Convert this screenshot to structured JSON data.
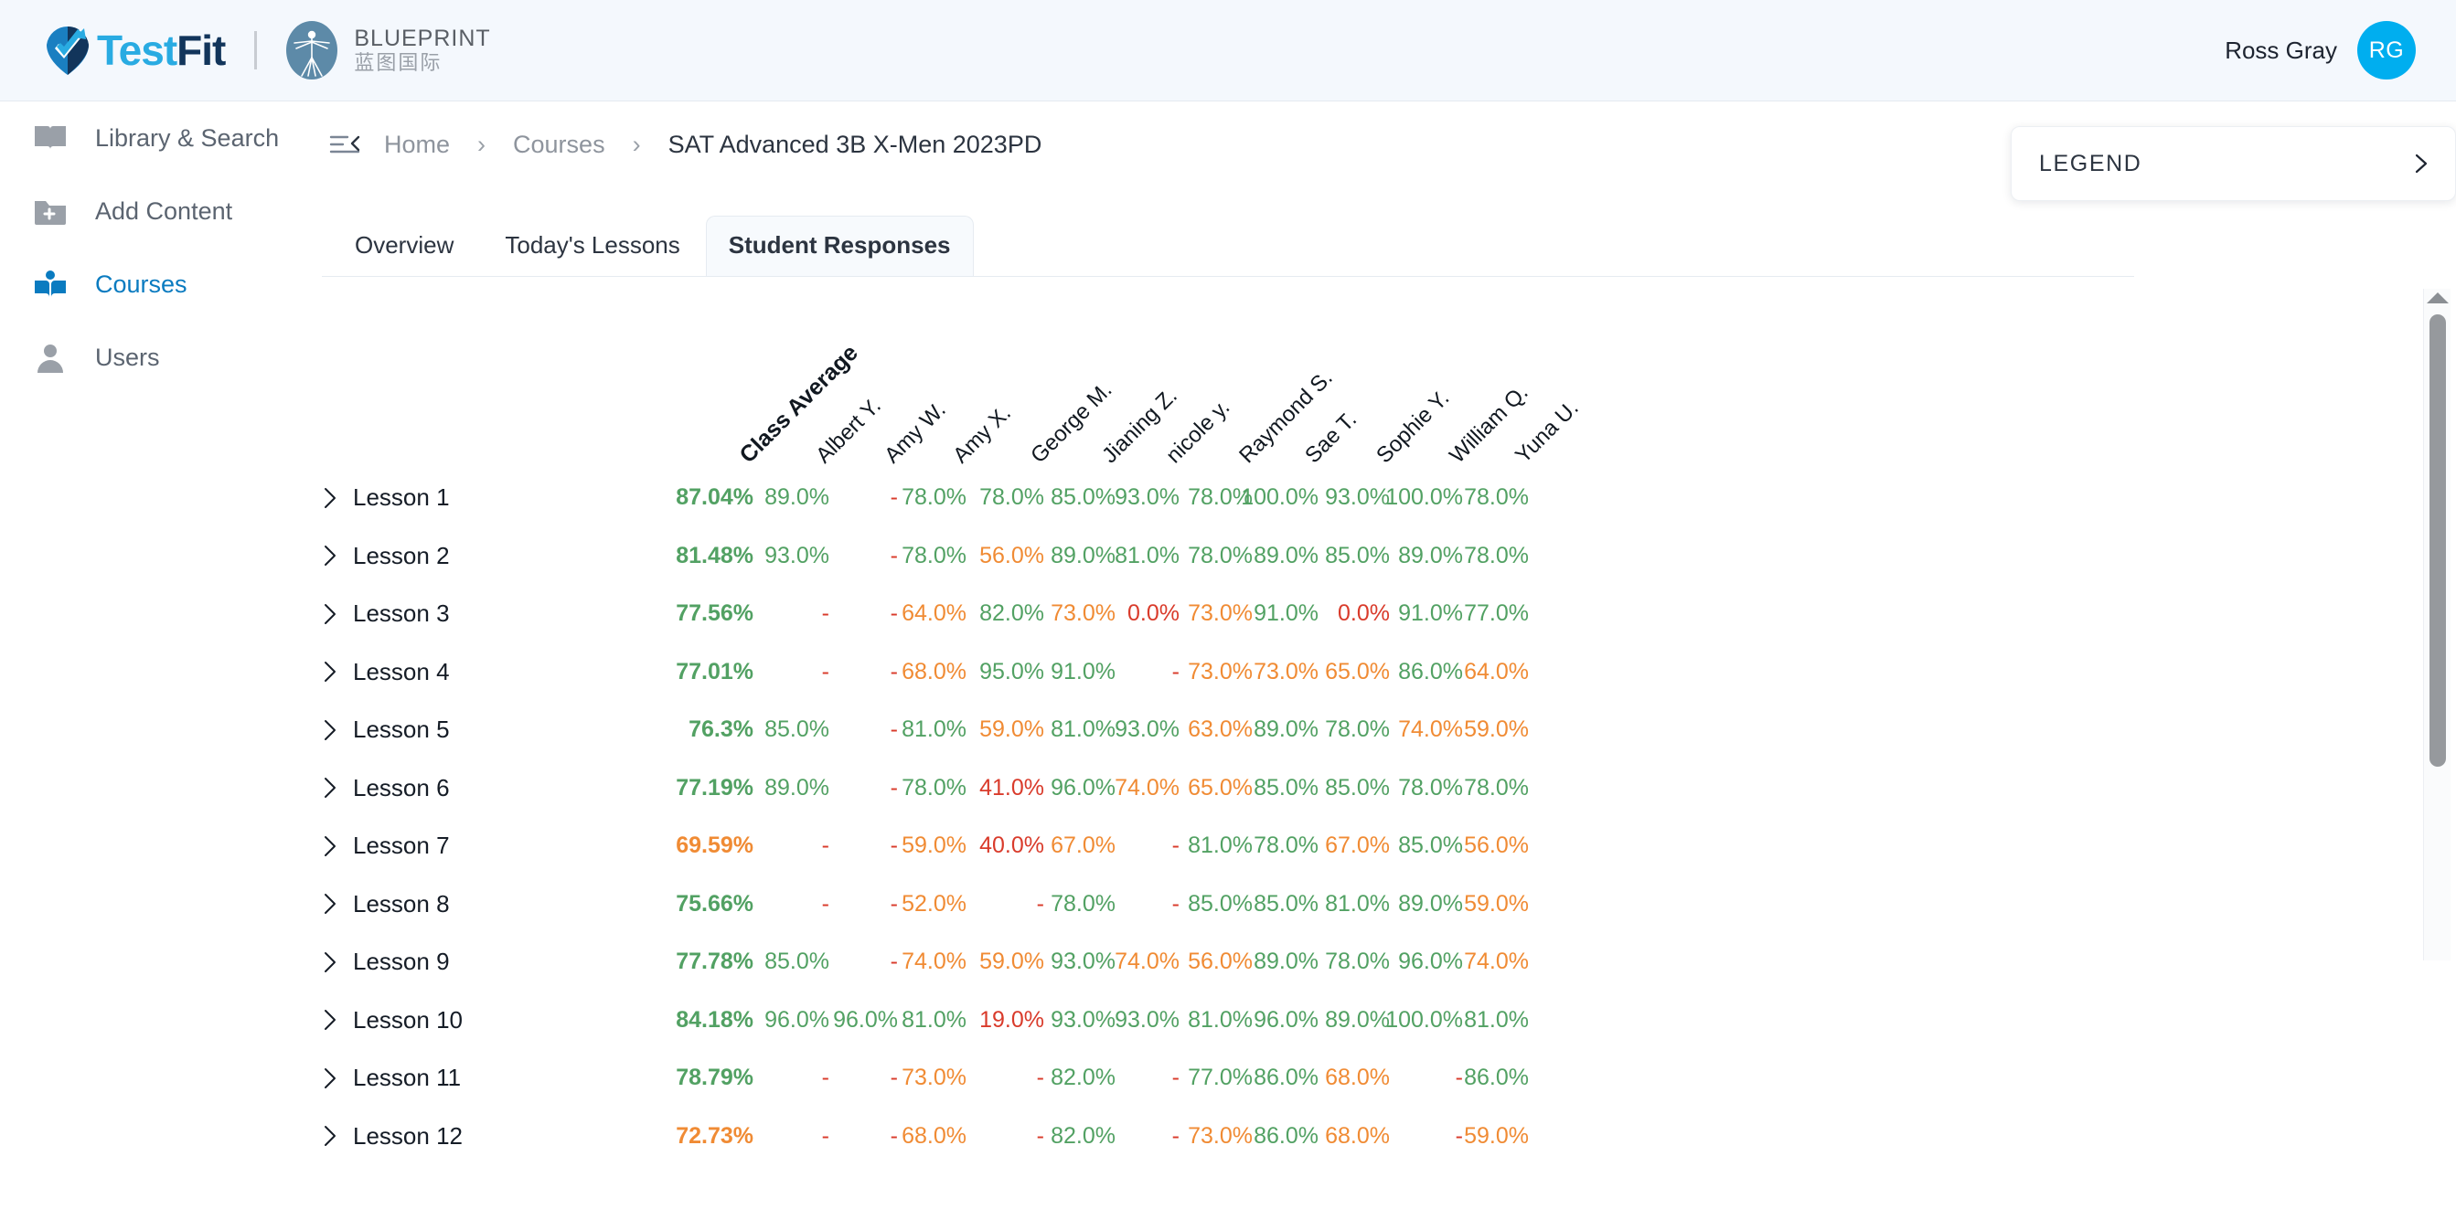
{
  "header": {
    "brand_test": "Test",
    "brand_fit": "Fit",
    "partner_en": "BLUEPRINT",
    "partner_cn": "蓝图国际",
    "user_name": "Ross Gray",
    "user_initials": "RG"
  },
  "sidebar": {
    "items": [
      {
        "label": "Library & Search",
        "icon": "book-icon",
        "active": false
      },
      {
        "label": "Add Content",
        "icon": "folder-plus-icon",
        "active": false
      },
      {
        "label": "Courses",
        "icon": "courses-icon",
        "active": true
      },
      {
        "label": "Users",
        "icon": "user-icon",
        "active": false
      }
    ]
  },
  "breadcrumb": {
    "home": "Home",
    "courses": "Courses",
    "current": "SAT Advanced 3B X-Men 2023PD",
    "separator": "›"
  },
  "legend": {
    "title": "LEGEND"
  },
  "tabs": [
    {
      "label": "Overview",
      "active": false
    },
    {
      "label": "Today's Lessons",
      "active": false
    },
    {
      "label": "Student Responses",
      "active": true
    }
  ],
  "colors": {
    "green": "#52a163",
    "orange": "#f08b34",
    "red": "#d93b2b",
    "accent_blue": "#0a7bc0",
    "avatar_blue": "#00aeef",
    "brand_light": "#29abe2",
    "brand_dark": "#12355b"
  },
  "chart_data": {
    "type": "table",
    "title": "Student Responses",
    "row_header": "Lesson",
    "columns": [
      "Class Average",
      "Albert Y.",
      "Amy W.",
      "Amy X.",
      "George M.",
      "Jianing Z.",
      "nicole y.",
      "Raymond S.",
      "Sae T.",
      "Sophie Y.",
      "William Q.",
      "Yuna U."
    ],
    "rows": [
      {
        "label": "Lesson 1",
        "values": [
          "87.04%",
          "89.0%",
          "-",
          "78.0%",
          "78.0%",
          "85.0%",
          "93.0%",
          "78.0%",
          "100.0%",
          "93.0%",
          "100.0%",
          "78.0%"
        ]
      },
      {
        "label": "Lesson 2",
        "values": [
          "81.48%",
          "93.0%",
          "-",
          "78.0%",
          "56.0%",
          "89.0%",
          "81.0%",
          "78.0%",
          "89.0%",
          "85.0%",
          "89.0%",
          "78.0%"
        ]
      },
      {
        "label": "Lesson 3",
        "values": [
          "77.56%",
          "-",
          "-",
          "64.0%",
          "82.0%",
          "73.0%",
          "0.0%",
          "73.0%",
          "91.0%",
          "0.0%",
          "91.0%",
          "77.0%"
        ]
      },
      {
        "label": "Lesson 4",
        "values": [
          "77.01%",
          "-",
          "-",
          "68.0%",
          "95.0%",
          "91.0%",
          "-",
          "73.0%",
          "73.0%",
          "65.0%",
          "86.0%",
          "64.0%"
        ]
      },
      {
        "label": "Lesson 5",
        "values": [
          "76.3%",
          "85.0%",
          "-",
          "81.0%",
          "59.0%",
          "81.0%",
          "93.0%",
          "63.0%",
          "89.0%",
          "78.0%",
          "74.0%",
          "59.0%"
        ]
      },
      {
        "label": "Lesson 6",
        "values": [
          "77.19%",
          "89.0%",
          "-",
          "78.0%",
          "41.0%",
          "96.0%",
          "74.0%",
          "65.0%",
          "85.0%",
          "85.0%",
          "78.0%",
          "78.0%"
        ]
      },
      {
        "label": "Lesson 7",
        "values": [
          "69.59%",
          "-",
          "-",
          "59.0%",
          "40.0%",
          "67.0%",
          "-",
          "81.0%",
          "78.0%",
          "67.0%",
          "85.0%",
          "56.0%"
        ]
      },
      {
        "label": "Lesson 8",
        "values": [
          "75.66%",
          "-",
          "-",
          "52.0%",
          "-",
          "78.0%",
          "-",
          "85.0%",
          "85.0%",
          "81.0%",
          "89.0%",
          "59.0%"
        ]
      },
      {
        "label": "Lesson 9",
        "values": [
          "77.78%",
          "85.0%",
          "-",
          "74.0%",
          "59.0%",
          "93.0%",
          "74.0%",
          "56.0%",
          "89.0%",
          "78.0%",
          "96.0%",
          "74.0%"
        ]
      },
      {
        "label": "Lesson 10",
        "values": [
          "84.18%",
          "96.0%",
          "96.0%",
          "81.0%",
          "19.0%",
          "93.0%",
          "93.0%",
          "81.0%",
          "96.0%",
          "89.0%",
          "100.0%",
          "81.0%"
        ]
      },
      {
        "label": "Lesson 11",
        "values": [
          "78.79%",
          "-",
          "-",
          "73.0%",
          "-",
          "82.0%",
          "-",
          "77.0%",
          "86.0%",
          "68.0%",
          "-",
          "86.0%"
        ]
      },
      {
        "label": "Lesson 12",
        "values": [
          "72.73%",
          "-",
          "-",
          "68.0%",
          "-",
          "82.0%",
          "-",
          "73.0%",
          "86.0%",
          "68.0%",
          "-",
          "59.0%"
        ]
      }
    ],
    "color_rules": {
      "green_min": 75,
      "orange_min": 50,
      "red_below": 50,
      "missing_token": "-"
    },
    "column_x": [
      472,
      555,
      630,
      705,
      790,
      868,
      938,
      1018,
      1090,
      1168,
      1248,
      1320
    ]
  }
}
